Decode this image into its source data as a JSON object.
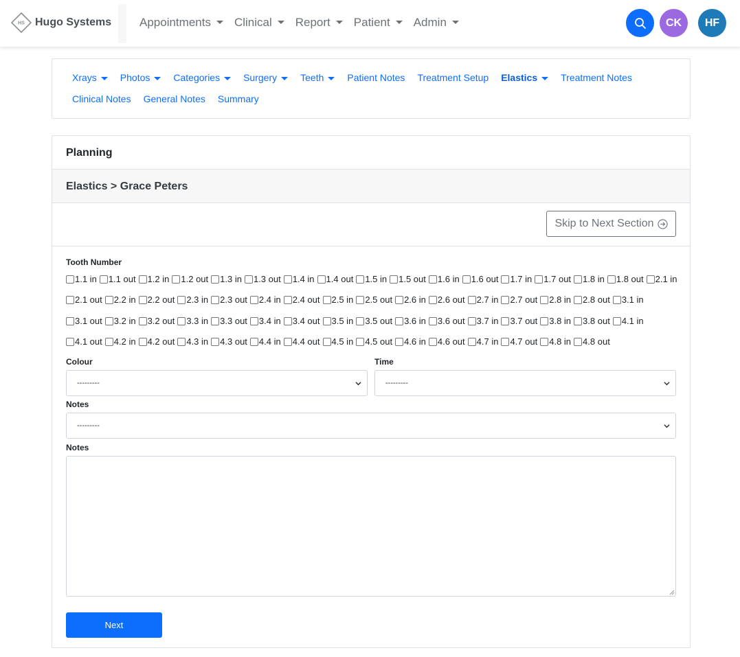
{
  "brand": {
    "name": "Hugo Systems",
    "logo_text": "HS"
  },
  "topnav": {
    "menu": [
      {
        "label": "Appointments"
      },
      {
        "label": "Clinical"
      },
      {
        "label": "Report"
      },
      {
        "label": "Patient"
      },
      {
        "label": "Admin"
      }
    ],
    "avatars": [
      {
        "initials": "CK",
        "color": "#9c6ae0"
      },
      {
        "initials": "HF",
        "color": "#1f7ab8"
      }
    ],
    "search_icon": "search-icon"
  },
  "subnav": {
    "row1": [
      {
        "label": "Xrays",
        "dropdown": true
      },
      {
        "label": "Photos",
        "dropdown": true
      },
      {
        "label": "Categories",
        "dropdown": true
      },
      {
        "label": "Surgery",
        "dropdown": true
      },
      {
        "label": "Teeth",
        "dropdown": true
      },
      {
        "label": "Patient Notes",
        "dropdown": false
      },
      {
        "label": "Treatment Setup",
        "dropdown": false
      },
      {
        "label": "Elastics",
        "dropdown": true,
        "active": true
      },
      {
        "label": "Treatment Notes",
        "dropdown": false
      }
    ],
    "row2": [
      {
        "label": "Clinical Notes"
      },
      {
        "label": "General Notes"
      },
      {
        "label": "Summary"
      }
    ]
  },
  "card": {
    "header": "Planning",
    "subheader": "Elastics > Grace Peters",
    "skip_label": "Skip to Next Section"
  },
  "form": {
    "tooth_number_label": "Tooth Number",
    "tooth_rows": [
      [
        "1.1 in",
        "1.1 out",
        "1.2 in",
        "1.2 out",
        "1.3 in",
        "1.3 out",
        "1.4 in",
        "1.4 out",
        "1.5 in",
        "1.5 out",
        "1.6 in",
        "1.6 out",
        "1.7 in",
        "1.7 out",
        "1.8 in",
        "1.8 out",
        "2.1 in"
      ],
      [
        "2.1 out",
        "2.2 in",
        "2.2 out",
        "2.3 in",
        "2.3 out",
        "2.4 in",
        "2.4 out",
        "2.5 in",
        "2.5 out",
        "2.6 in",
        "2.6 out",
        "2.7 in",
        "2.7 out",
        "2.8 in",
        "2.8 out",
        "3.1 in"
      ],
      [
        "3.1 out",
        "3.2 in",
        "3.2 out",
        "3.3 in",
        "3.3 out",
        "3.4 in",
        "3.4 out",
        "3.5 in",
        "3.5 out",
        "3.6 in",
        "3.6 out",
        "3.7 in",
        "3.7 out",
        "3.8 in",
        "3.8 out",
        "4.1 in"
      ],
      [
        "4.1 out",
        "4.2 in",
        "4.2 out",
        "4.3 in",
        "4.3 out",
        "4.4 in",
        "4.4 out",
        "4.5 in",
        "4.5 out",
        "4.6 in",
        "4.6 out",
        "4.7 in",
        "4.7 out",
        "4.8 in",
        "4.8 out"
      ]
    ],
    "colour_label": "Colour",
    "colour_value": "---------",
    "time_label": "Time",
    "time_value": "---------",
    "notes_select_label": "Notes",
    "notes_select_value": "---------",
    "notes_text_label": "Notes",
    "notes_text_value": "",
    "next_label": "Next"
  },
  "colors": {
    "primary": "#0d6efd",
    "border": "#dee2e6",
    "muted": "#6c757d"
  }
}
